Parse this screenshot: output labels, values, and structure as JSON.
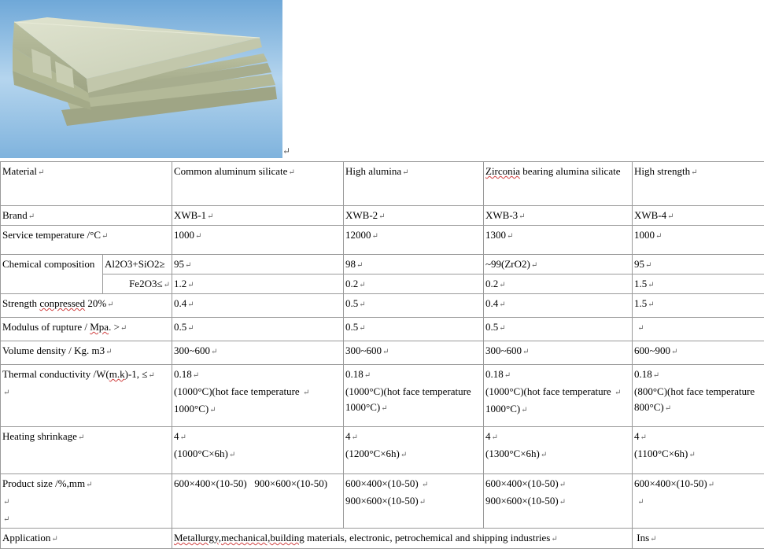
{
  "photo": {
    "alt_subject": "ceramic-fiber-board-stack"
  },
  "paragraph_mark": "↵",
  "header": {
    "label": "Material",
    "cols": [
      "Common aluminum silicate",
      "High alumina",
      "Zirconia bearing alumina silicate",
      "High strength"
    ],
    "zirconia_word": "Zirconia",
    "zirconia_rest": " bearing alumina silicate"
  },
  "brand": {
    "label": "Brand",
    "values": [
      "XWB-1",
      "XWB-2",
      "XWB-3",
      "XWB-4"
    ]
  },
  "service_temp": {
    "label": " Service temperature /°C",
    "values": [
      "1000",
      "12000",
      "1300",
      "1000"
    ]
  },
  "chem": {
    "label": "Chemical composition",
    "sub1": "Al2O3+SiO2≥",
    "sub1_values": [
      "95",
      "98",
      "~99(ZrO2)",
      "95"
    ],
    "sub2": "Fe2O3≤",
    "sub2_values": [
      "1.2",
      "0.2",
      "0.2",
      "1.5"
    ]
  },
  "strength": {
    "label_pre": "Strength ",
    "label_wavy": "conpressed",
    "label_post": " 20%",
    "values": [
      "0.4",
      "0.5",
      "0.4",
      "1.5"
    ]
  },
  "modulus": {
    "label_pre": "Modulus of rupture / ",
    "label_wavy": "Mpa",
    "label_post": ". >",
    "values": [
      "0.5",
      "0.5",
      "0.5",
      ""
    ]
  },
  "density": {
    "label": "Volume density / Kg. m3",
    "values": [
      "300~600",
      "300~600",
      "300~600",
      "600~900"
    ]
  },
  "thermal": {
    "label_pre": "Thermal conductivity /W(",
    "label_wavy": "m.k",
    "label_post": ")-1, ≤",
    "values": [
      {
        "l1": "0.18",
        "l2": "(1000°C)(hot face temperature ",
        "l3": "1000°C)"
      },
      {
        "l1": "0.18",
        "l2": "(1000°C)(hot face temperature",
        "l3": " 1000°C)"
      },
      {
        "l1": "0.18",
        "l2": "(1000°C)(hot face temperature ",
        "l3": "1000°C)"
      },
      {
        "l1": "0.18",
        "l2": "(800°C)(hot face temperature",
        "l3": "800°C)"
      }
    ]
  },
  "shrinkage": {
    "label": "Heating shrinkage",
    "values": [
      {
        "l1": "4",
        "l2": "(1000°C×6h)"
      },
      {
        "l1": "4",
        "l2": "(1200°C×6h)"
      },
      {
        "l1": "4",
        "l2": "(1300°C×6h)"
      },
      {
        "l1": "4",
        "l2": "(1100°C×6h)"
      }
    ]
  },
  "product_size": {
    "label": "Product size /%,mm",
    "values": [
      {
        "l1": "600×400×(10-50)   900×600×(10-50)",
        "l2": ""
      },
      {
        "l1": "600×400×(10-50) ",
        "l2": "900×600×(10-50)"
      },
      {
        "l1": "600×400×(10-50)",
        "l2": "900×600×(10-50)"
      },
      {
        "l1": "600×400×(10-50)",
        "l2": ""
      }
    ]
  },
  "application": {
    "label": "Application",
    "value_wavy1": "Metallurgy",
    "value_mid": ",",
    "value_wavy2": "mechanical,building",
    "value_rest": " materials, electronic, petrochemical and shipping industries",
    "last": "Ins"
  }
}
